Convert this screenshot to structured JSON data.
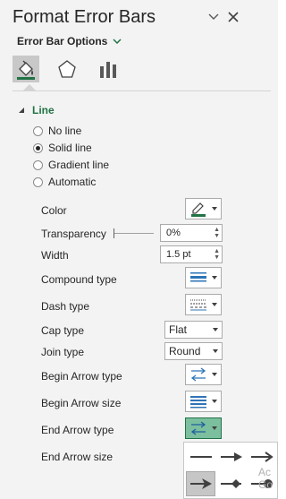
{
  "pane": {
    "title": "Format Error Bars",
    "options_label": "Error Bar Options",
    "tabs": [
      {
        "name": "fill-line",
        "icon": "paint-bucket-icon",
        "active": true
      },
      {
        "name": "effects",
        "icon": "pentagon-icon",
        "active": false
      },
      {
        "name": "bar-options",
        "icon": "bar-chart-icon",
        "active": false
      }
    ]
  },
  "section": {
    "title": "Line"
  },
  "line_options": [
    {
      "label": "No line",
      "selected": false
    },
    {
      "label": "Solid line",
      "selected": true
    },
    {
      "label": "Gradient line",
      "selected": false
    },
    {
      "label": "Automatic",
      "selected": false
    }
  ],
  "props": {
    "color_label": "Color",
    "transparency_label": "Transparency",
    "transparency_value": "0%",
    "width_label": "Width",
    "width_value": "1.5 pt",
    "compound_label": "Compound type",
    "dash_label": "Dash type",
    "cap_label": "Cap type",
    "cap_value": "Flat",
    "join_label": "Join type",
    "join_value": "Round",
    "begin_arrow_type_label": "Begin Arrow type",
    "begin_arrow_size_label": "Begin Arrow size",
    "end_arrow_type_label": "End Arrow type",
    "end_arrow_size_label": "End Arrow size"
  },
  "arrow_gallery": {
    "items": [
      "line-no-arrow",
      "arrow-filled",
      "arrow-open",
      "arrow-stealth",
      "arrow-diamond",
      "arrow-oval"
    ],
    "selected_index": 3
  },
  "watermark": {
    "line1": "Ac",
    "line2": "Go"
  },
  "colors": {
    "accent": "#217346",
    "selected_button": "#7cbf9e",
    "pane_bg": "#f3f3f3"
  }
}
